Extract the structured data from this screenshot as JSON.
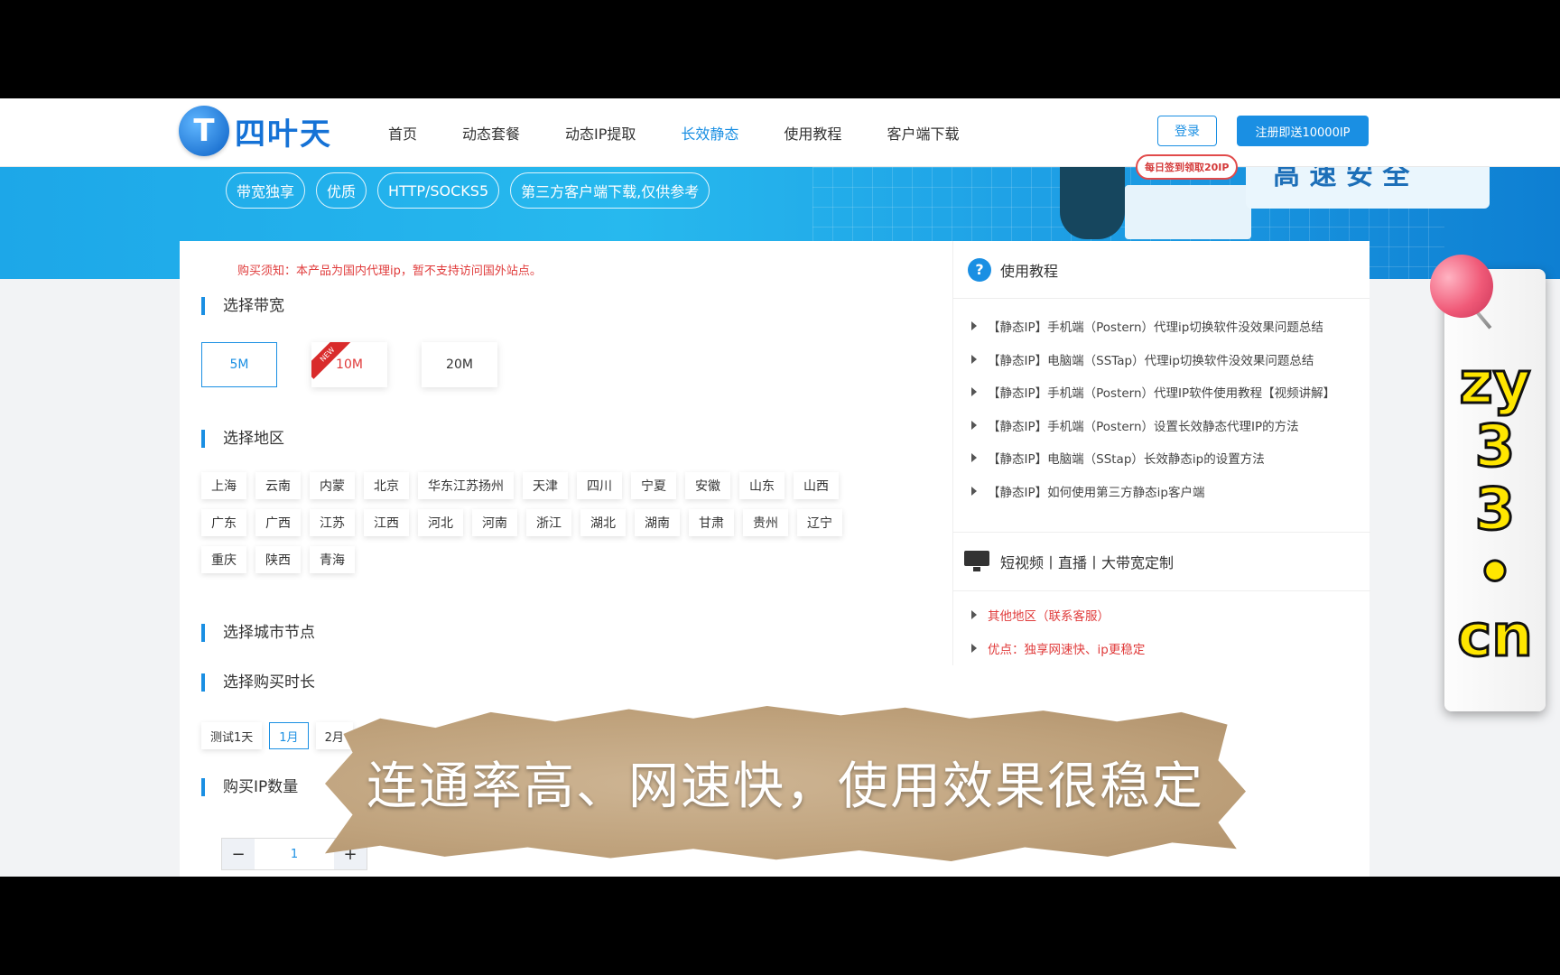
{
  "header": {
    "logo_mark": "T",
    "logo_text": "四叶天",
    "nav": [
      "首页",
      "动态套餐",
      "动态IP提取",
      "长效静态",
      "使用教程",
      "客户端下载"
    ],
    "active_nav": "长效静态",
    "login": "登录",
    "register": "注册即送10000IP"
  },
  "banner": {
    "tags": [
      "带宽独享",
      "优质",
      "HTTP/SOCKS5",
      "第三方客户端下载,仅供参考"
    ],
    "sign_badge": "每日签到领取20IP",
    "board_text": "高 速 安 全"
  },
  "main": {
    "notice": "购买须知：本产品为国内代理ip，暂不支持访问国外站点。",
    "bandwidth_title": "选择带宽",
    "bandwidth_options": [
      "5M",
      "10M",
      "20M"
    ],
    "bandwidth_selected": "5M",
    "new_flag": "NEW",
    "region_title": "选择地区",
    "regions": [
      "上海",
      "云南",
      "内蒙",
      "北京",
      "华东江苏扬州",
      "天津",
      "四川",
      "宁夏",
      "安徽",
      "山东",
      "山西",
      "广东",
      "广西",
      "江苏",
      "江西",
      "河北",
      "河南",
      "浙江",
      "湖北",
      "湖南",
      "甘肃",
      "贵州",
      "辽宁",
      "重庆",
      "陕西",
      "青海"
    ],
    "city_title": "选择城市节点",
    "duration_title": "选择购买时长",
    "durations": [
      "测试1天",
      "1月",
      "2月"
    ],
    "duration_selected": "1月",
    "quantity_title": "购买IP数量",
    "quantity_minus": "−",
    "quantity_value": "1",
    "quantity_plus": "+"
  },
  "sidebar": {
    "tutorial_title": "使用教程",
    "tutorials": [
      "【静态IP】手机端（Postern）代理ip切换软件没效果问题总结",
      "【静态IP】电脑端（SSTap）代理ip切换软件没效果问题总结",
      "【静态IP】手机端（Postern）代理IP软件使用教程【视频讲解】",
      "【静态IP】手机端（Postern）设置长效静态代理IP的方法",
      "【静态IP】电脑端（SStap）长效静态ip的设置方法",
      "【静态IP】如何使用第三方静态ip客户端"
    ],
    "custom_title": "短视频丨直播丨大带宽定制",
    "custom_items": [
      "其他地区（联系客服）",
      "优点：独享网速快、ip更稳定"
    ]
  },
  "overlay": {
    "subtitle": "连通率高、网速快，使用效果很稳定",
    "vertical_chars": [
      "zy",
      "3",
      "3",
      "•",
      "cn"
    ]
  },
  "colors": {
    "accent": "#1a8fe3",
    "notice_red": "#e03b3b",
    "watermark_yellow": "#ffe600"
  }
}
